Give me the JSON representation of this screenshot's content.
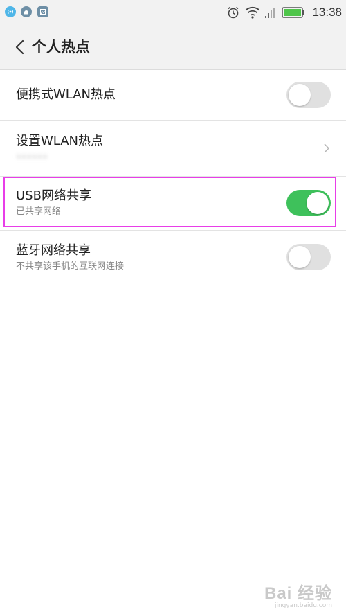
{
  "status_bar": {
    "time": "13:38",
    "left_icons": [
      "hotspot-icon",
      "android-icon",
      "image-icon"
    ],
    "right_icons": [
      "alarm-icon",
      "wifi-icon",
      "signal-icon",
      "battery-icon"
    ]
  },
  "header": {
    "title": "个人热点",
    "back_icon": "chevron-left-icon"
  },
  "settings": [
    {
      "title": "便携式WLAN热点",
      "subtitle": "",
      "control": "toggle",
      "state": "off"
    },
    {
      "title": "设置WLAN热点",
      "subtitle": "••••••",
      "control": "chevron",
      "state": ""
    },
    {
      "title": "USB网络共享",
      "subtitle": "已共享网络",
      "control": "toggle",
      "state": "on"
    },
    {
      "title": "蓝牙网络共享",
      "subtitle": "不共享该手机的互联网连接",
      "control": "toggle",
      "state": "off"
    }
  ],
  "colors": {
    "accent_green": "#3ec15b",
    "toggle_off": "#e0e0e0",
    "highlight": "#e83ee8",
    "status_icon_blue": "#4fb6e8"
  },
  "watermark": {
    "main": "Bai 经验",
    "sub": "jingyan.baidu.com"
  }
}
